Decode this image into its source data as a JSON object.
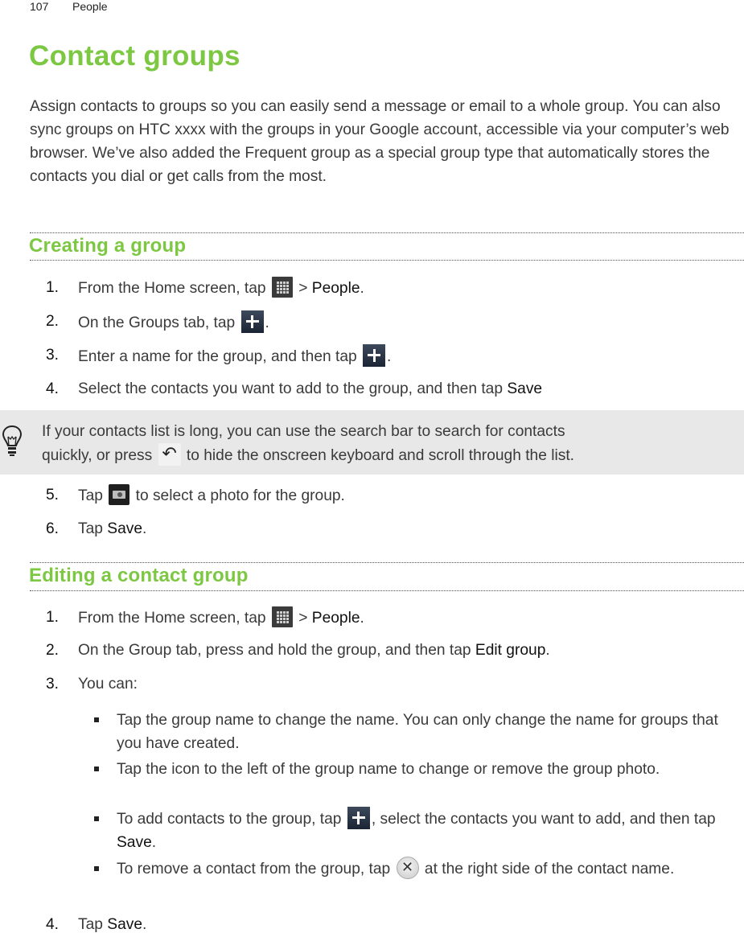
{
  "header": {
    "page_number": "107",
    "chapter": "People"
  },
  "title": "Contact groups",
  "intro": "Assign contacts to groups so you can easily send a message or email to a whole group. You can also sync groups on HTC xxxx with the groups in your Google account, accessible via your computer’s web browser. We’ve also added the Frequent group as a special group type that automatically stores the contacts you dial or get calls from the most.",
  "sections": {
    "creating": {
      "title": "Creating a group",
      "steps": [
        {
          "num": "1.",
          "pre": "From the Home screen, tap",
          "icon": "apps-grid-icon",
          "post": " > ",
          "bold": "People",
          "end": "."
        },
        {
          "num": "2.",
          "pre": "On the Groups tab, tap",
          "icon": "add-plus-icon",
          "end": "."
        },
        {
          "num": "3.",
          "pre": "Enter a name for the group, and then tap",
          "icon": "add-plus-icon",
          "end": "."
        },
        {
          "num": "4.",
          "pre": "Select the contacts you want to add to the group, and then tap ",
          "bold": "Save"
        },
        {
          "num": "5.",
          "pre": "Tap",
          "icon": "camera-icon",
          "post": " to select a photo for the group."
        },
        {
          "num": "6.",
          "pre": "Tap ",
          "bold": "Save",
          "end": "."
        }
      ],
      "tip": {
        "icon": "lightbulb-icon",
        "line1": "If your contacts list is long, you can use the search bar to search for contacts",
        "line2_pre": "quickly, or press",
        "line2_icon": "back-arrow-icon",
        "line2_post": " to hide the onscreen keyboard and scroll through the list."
      }
    },
    "editing": {
      "title": "Editing a contact group",
      "steps": [
        {
          "num": "1.",
          "pre": "From the Home screen, tap",
          "icon": "apps-grid-icon",
          "post": " > ",
          "bold": "People",
          "end": "."
        },
        {
          "num": "2.",
          "pre": "On the Group tab, press and hold the group, and then tap ",
          "bold": "Edit group",
          "end": "."
        },
        {
          "num": "3.",
          "pre": "You can:"
        },
        {
          "num": "4.",
          "pre": "Tap ",
          "bold": "Save",
          "end": "."
        }
      ],
      "bullets": [
        {
          "text": "Tap the group name to change the name. You can only change the name for groups that you have created."
        },
        {
          "text": "Tap the icon to the left of the group name to change or remove the group photo."
        },
        {
          "pre": "To add contacts to the group, tap",
          "icon": "add-plus-icon",
          "post": ", select the contacts you want to add, and then tap ",
          "bold": "Save",
          "end": "."
        },
        {
          "pre": "To remove a contact from the group, tap",
          "icon": "remove-x-icon",
          "post": " at the right side of the contact name."
        }
      ]
    }
  },
  "colors": {
    "heading_green": "#7dc843",
    "tip_background": "#e8e8e8",
    "body_text": "#3a3a3a"
  }
}
